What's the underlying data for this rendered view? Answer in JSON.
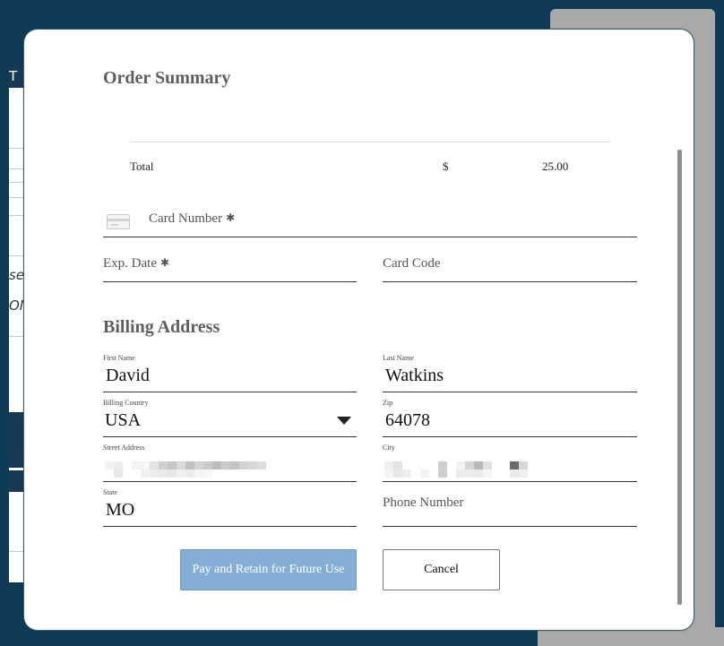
{
  "background": {
    "fragments": [
      "T",
      "se",
      "ON"
    ]
  },
  "order_summary": {
    "title": "Order Summary",
    "total_label": "Total",
    "currency": "$",
    "total_amount": "25.00"
  },
  "payment": {
    "card_number_placeholder": "Card Number",
    "exp_date_placeholder": "Exp. Date",
    "card_code_placeholder": "Card Code",
    "required_mark": "✱"
  },
  "billing": {
    "title": "Billing Address",
    "first_name": {
      "label": "First Name",
      "value": "David"
    },
    "last_name": {
      "label": "Last Name",
      "value": "Watkins"
    },
    "country": {
      "label": "Billing Country",
      "value": "USA"
    },
    "zip": {
      "label": "Zip",
      "value": "64078"
    },
    "street": {
      "label": "Street Address",
      "value": ""
    },
    "city": {
      "label": "City",
      "value": ""
    },
    "state": {
      "label": "State",
      "value": "MO"
    },
    "phone_placeholder": "Phone Number"
  },
  "actions": {
    "pay_label": "Pay and Retain for Future Use",
    "cancel_label": "Cancel"
  },
  "colors": {
    "backdrop": "#0e3a55",
    "pay_button": "#85aed7",
    "heading": "#5f5f5f"
  }
}
